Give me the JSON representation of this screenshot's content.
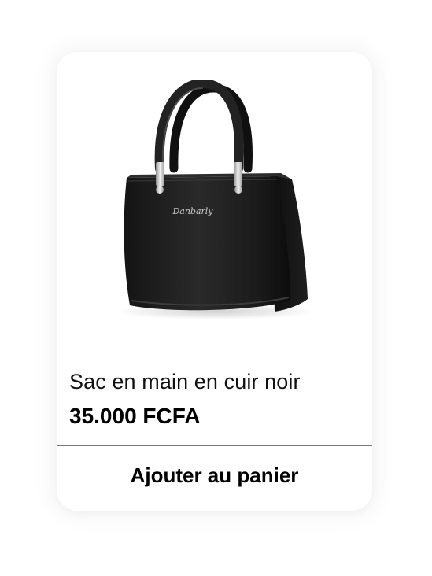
{
  "product": {
    "image_icon": "black-leather-handbag-image",
    "logo_text": "Danbarly",
    "title": "Sac en main en cuir noir",
    "price": "35.000 FCFA",
    "add_to_cart_label": "Ajouter au panier"
  },
  "colors": {
    "card_background": "#ffffff",
    "text": "#111111",
    "divider": "#777777",
    "bag": "#1a1a1a"
  }
}
